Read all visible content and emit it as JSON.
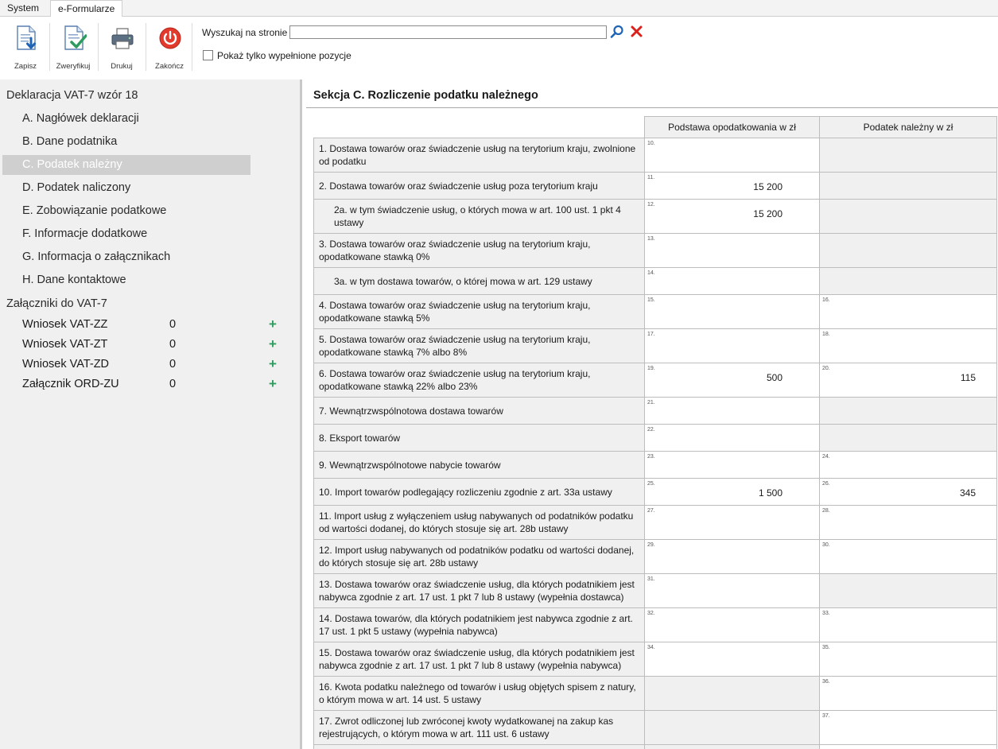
{
  "tabs": [
    "System",
    "e-Formularze"
  ],
  "toolbar": {
    "buttons": [
      {
        "label": "Zapisz",
        "icon": "save-icon"
      },
      {
        "label": "Zweryfikuj",
        "icon": "verify-icon"
      },
      {
        "label": "Drukuj",
        "icon": "printer-icon"
      },
      {
        "label": "Zakończ",
        "icon": "power-icon"
      }
    ],
    "search_label": "Wyszukaj na stronie",
    "search_value": "",
    "filled_only_label": "Pokaż tylko wypełnione pozycje",
    "filled_only_checked": false
  },
  "nav": {
    "header": "Deklaracja VAT-7 wzór 18",
    "items": [
      "A. Nagłówek deklaracji",
      "B. Dane podatnika",
      "C. Podatek należny",
      "D. Podatek naliczony",
      "E. Zobowiązanie podatkowe",
      "F. Informacje dodatkowe",
      "G. Informacja o załącznikach",
      "H. Dane kontaktowe"
    ],
    "active_index": 2,
    "attachments_header": "Załączniki do VAT-7",
    "attachments": [
      {
        "name": "Wniosek VAT-ZZ",
        "count": "0"
      },
      {
        "name": "Wniosek VAT-ZT",
        "count": "0"
      },
      {
        "name": "Wniosek VAT-ZD",
        "count": "0"
      },
      {
        "name": "Załącznik ORD-ZU",
        "count": "0"
      }
    ],
    "add_glyph": "+"
  },
  "section": {
    "title": "Sekcja C. Rozliczenie podatku należnego",
    "col_base": "Podstawa opodatkowania w zł",
    "col_tax": "Podatek należny w zł",
    "rows": [
      {
        "desc": "1. Dostawa towarów oraz świadczenie usług na terytorium kraju, zwolnione od podatku",
        "base_no": "10.",
        "base_val": "",
        "tax_no": "",
        "tax_val": "",
        "base_dis": false,
        "tax_dis": true
      },
      {
        "desc": "2. Dostawa towarów oraz świadczenie usług poza terytorium kraju",
        "base_no": "11.",
        "base_val": "15 200",
        "tax_no": "",
        "tax_val": "",
        "base_dis": false,
        "tax_dis": true
      },
      {
        "desc": "2a. w tym świadczenie usług, o których mowa w art. 100 ust. 1 pkt 4 ustawy",
        "indent": true,
        "base_no": "12.",
        "base_val": "15 200",
        "tax_no": "",
        "tax_val": "",
        "base_dis": false,
        "tax_dis": true
      },
      {
        "desc": "3. Dostawa towarów oraz świadczenie usług na terytorium kraju, opodatkowane stawką 0%",
        "base_no": "13.",
        "base_val": "",
        "tax_no": "",
        "tax_val": "",
        "base_dis": false,
        "tax_dis": true
      },
      {
        "desc": "3a. w tym dostawa towarów, o której mowa w art. 129 ustawy",
        "indent": true,
        "base_no": "14.",
        "base_val": "",
        "tax_no": "",
        "tax_val": "",
        "base_dis": false,
        "tax_dis": true
      },
      {
        "desc": "4. Dostawa towarów oraz świadczenie usług na terytorium kraju, opodatkowane stawką 5%",
        "base_no": "15.",
        "base_val": "",
        "tax_no": "16.",
        "tax_val": "",
        "base_dis": false,
        "tax_dis": false
      },
      {
        "desc": "5. Dostawa towarów oraz świadczenie usług na terytorium kraju, opodatkowane stawką 7% albo 8%",
        "base_no": "17.",
        "base_val": "",
        "tax_no": "18.",
        "tax_val": "",
        "base_dis": false,
        "tax_dis": false
      },
      {
        "desc": "6. Dostawa towarów oraz świadczenie usług na terytorium kraju, opodatkowane stawką 22% albo 23%",
        "base_no": "19.",
        "base_val": "500",
        "tax_no": "20.",
        "tax_val": "115",
        "base_dis": false,
        "tax_dis": false
      },
      {
        "desc": "7. Wewnątrzwspólnotowa dostawa towarów",
        "base_no": "21.",
        "base_val": "",
        "tax_no": "",
        "tax_val": "",
        "base_dis": false,
        "tax_dis": true
      },
      {
        "desc": "8. Eksport towarów",
        "base_no": "22.",
        "base_val": "",
        "tax_no": "",
        "tax_val": "",
        "base_dis": false,
        "tax_dis": true
      },
      {
        "desc": "9. Wewnątrzwspólnotowe nabycie towarów",
        "base_no": "23.",
        "base_val": "",
        "tax_no": "24.",
        "tax_val": "",
        "base_dis": false,
        "tax_dis": false
      },
      {
        "desc": "10. Import towarów podlegający rozliczeniu zgodnie z art. 33a ustawy",
        "base_no": "25.",
        "base_val": "1 500",
        "tax_no": "26.",
        "tax_val": "345",
        "base_dis": false,
        "tax_dis": false
      },
      {
        "desc": "11. Import usług z wyłączeniem usług nabywanych od podatników podatku od wartości dodanej, do których stosuje się art. 28b ustawy",
        "base_no": "27.",
        "base_val": "",
        "tax_no": "28.",
        "tax_val": "",
        "base_dis": false,
        "tax_dis": false
      },
      {
        "desc": "12. Import usług nabywanych od podatników podatku od wartości dodanej, do których stosuje się art. 28b ustawy",
        "base_no": "29.",
        "base_val": "",
        "tax_no": "30.",
        "tax_val": "",
        "base_dis": false,
        "tax_dis": false
      },
      {
        "desc": "13. Dostawa towarów oraz świadczenie usług, dla których podatnikiem jest nabywca zgodnie z art. 17 ust. 1 pkt 7 lub 8 ustawy (wypełnia dostawca)",
        "base_no": "31.",
        "base_val": "",
        "tax_no": "",
        "tax_val": "",
        "base_dis": false,
        "tax_dis": true
      },
      {
        "desc": "14. Dostawa towarów, dla których podatnikiem jest nabywca zgodnie z art. 17 ust. 1 pkt 5 ustawy (wypełnia nabywca)",
        "base_no": "32.",
        "base_val": "",
        "tax_no": "33.",
        "tax_val": "",
        "base_dis": false,
        "tax_dis": false
      },
      {
        "desc": "15. Dostawa towarów oraz świadczenie usług, dla których podatnikiem jest nabywca zgodnie z art. 17 ust. 1 pkt 7 lub 8 ustawy (wypełnia nabywca)",
        "base_no": "34.",
        "base_val": "",
        "tax_no": "35.",
        "tax_val": "",
        "base_dis": false,
        "tax_dis": false
      },
      {
        "desc": "16. Kwota podatku należnego od towarów i usług objętych spisem z natury, o którym mowa w art. 14 ust. 5 ustawy",
        "base_no": "",
        "base_val": "",
        "tax_no": "36.",
        "tax_val": "",
        "base_dis": true,
        "tax_dis": false
      },
      {
        "desc": "17. Zwrot odliczonej lub zwróconej kwoty wydatkowanej na zakup kas rejestrujących, o którym mowa w art. 111 ust. 6 ustawy",
        "base_no": "",
        "base_val": "",
        "tax_no": "37.",
        "tax_val": "",
        "base_dis": true,
        "tax_dis": false
      },
      {
        "desc": "",
        "base_no": "",
        "base_val": "",
        "tax_no": "",
        "tax_val": "",
        "base_dis": true,
        "tax_dis": false
      }
    ]
  }
}
